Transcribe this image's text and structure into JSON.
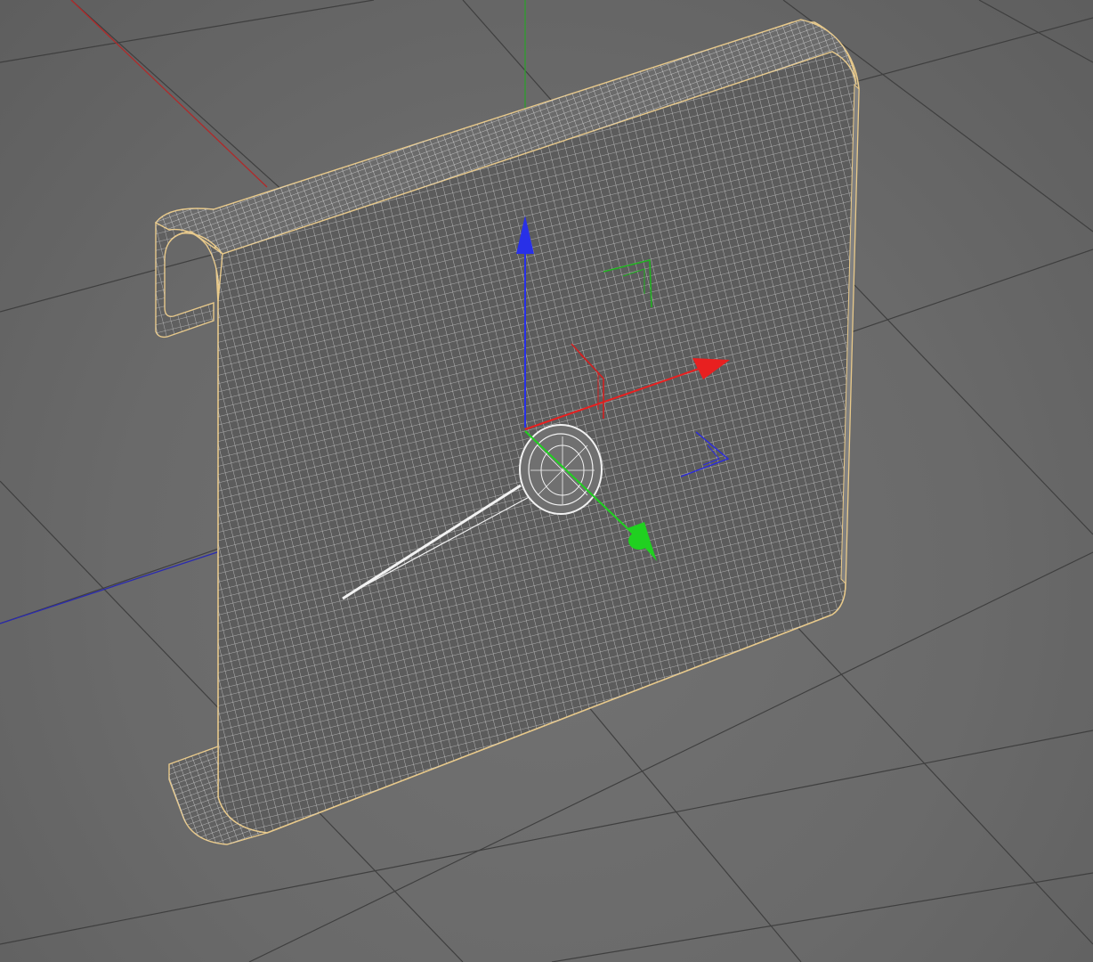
{
  "viewport": {
    "background": "#6a6a6a",
    "grid_line_color": "#3f3f3f",
    "wireframe_color": "#e6e6e6",
    "selection_outline_color": "#e8c98a"
  },
  "world_axes": {
    "x_color": "#b02a2a",
    "y_color": "#2e9e2e",
    "z_color": "#2a2ab0"
  },
  "gizmo": {
    "x_icon": "arrow-red-x",
    "y_icon": "arrow-blue-y",
    "z_icon": "arrow-green-z",
    "x_color": "#e82020",
    "y_color": "#2830e8",
    "z_color": "#20d020"
  },
  "object": {
    "type": "bent-sheet-mesh",
    "name_icon": "polygon-mesh-icon"
  },
  "light": {
    "type": "spot-light",
    "icon": "spotlight-icon"
  }
}
